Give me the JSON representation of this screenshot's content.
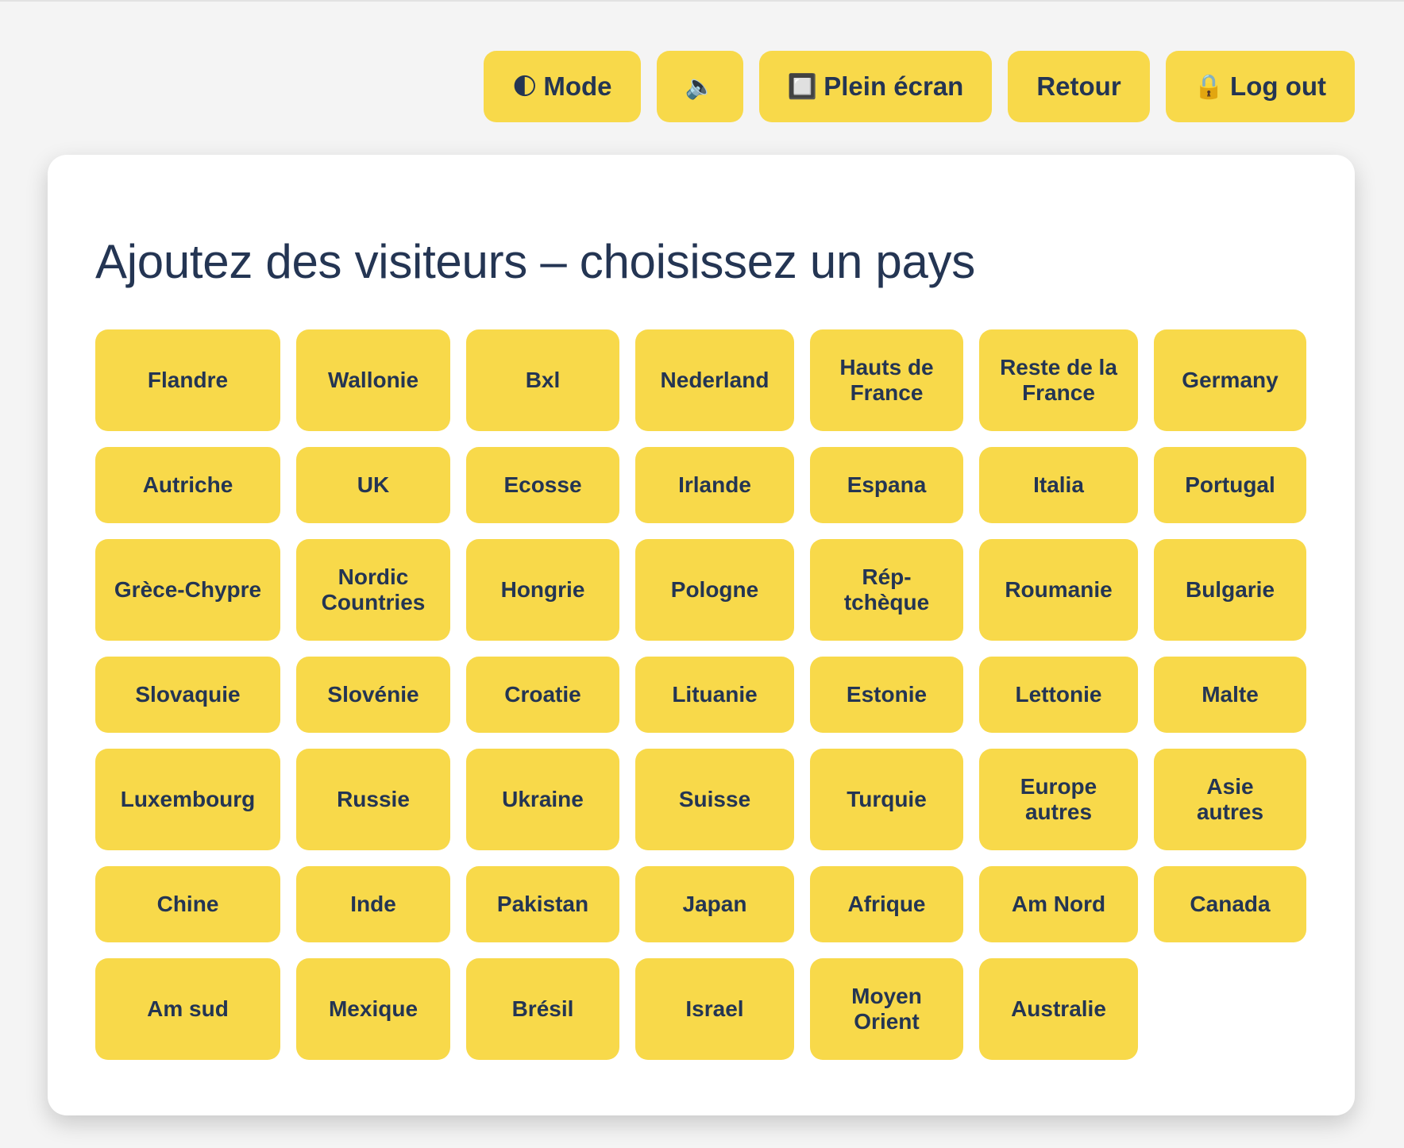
{
  "toolbar": {
    "mode": {
      "icon": "🌓",
      "label": "Mode"
    },
    "sound": {
      "icon": "🔈"
    },
    "fullscreen": {
      "icon": "🔲",
      "label": "Plein écran"
    },
    "back": {
      "label": "Retour"
    },
    "logout": {
      "icon": "🔒",
      "label": "Log out"
    }
  },
  "main": {
    "title": "Ajoutez des visiteurs – choisissez un pays",
    "countries": [
      "Flandre",
      "Wallonie",
      "Bxl",
      "Nederland",
      "Hauts de France",
      "Reste de la France",
      "Germany",
      "Autriche",
      "UK",
      "Ecosse",
      "Irlande",
      "Espana",
      "Italia",
      "Portugal",
      "Grèce-Chypre",
      "Nordic Countries",
      "Hongrie",
      "Pologne",
      "Rép-tchèque",
      "Roumanie",
      "Bulgarie",
      "Slovaquie",
      "Slovénie",
      "Croatie",
      "Lituanie",
      "Estonie",
      "Lettonie",
      "Malte",
      "Luxembourg",
      "Russie",
      "Ukraine",
      "Suisse",
      "Turquie",
      "Europe autres",
      "Asie autres",
      "Chine",
      "Inde",
      "Pakistan",
      "Japan",
      "Afrique",
      "Am Nord",
      "Canada",
      "Am sud",
      "Mexique",
      "Brésil",
      "Israel",
      "Moyen Orient",
      "Australie"
    ]
  },
  "colors": {
    "background": "#f4f4f4",
    "card": "#ffffff",
    "button": "#f8d94a",
    "text": "#243553"
  }
}
